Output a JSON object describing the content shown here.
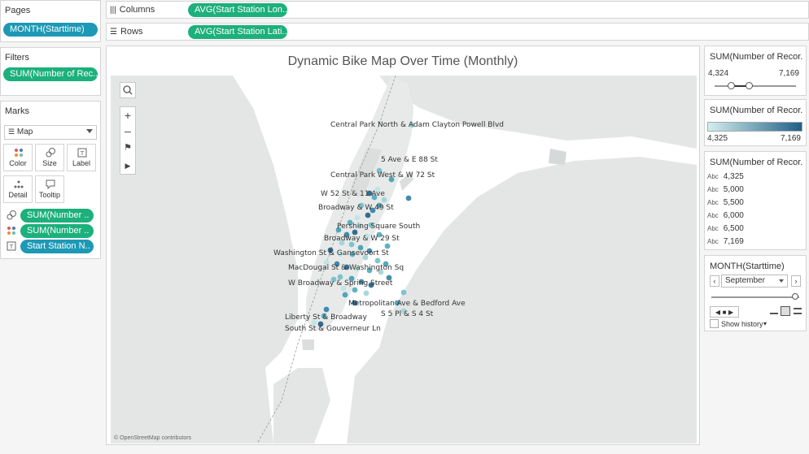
{
  "pages": {
    "title": "Pages",
    "pill": "MONTH(Starttime)"
  },
  "filters": {
    "title": "Filters",
    "pill": "SUM(Number of Rec.."
  },
  "marks": {
    "title": "Marks",
    "type": "Map",
    "cards": [
      {
        "label": "Color",
        "icon": "color-dots-icon"
      },
      {
        "label": "Size",
        "icon": "size-icon"
      },
      {
        "label": "Label",
        "icon": "label-icon"
      },
      {
        "label": "Detail",
        "icon": "detail-icon"
      },
      {
        "label": "Tooltip",
        "icon": "tooltip-icon"
      }
    ],
    "fields": [
      {
        "label": "SUM(Number ..",
        "icon": "size-icon"
      },
      {
        "label": "SUM(Number ..",
        "icon": "color-dots-icon"
      },
      {
        "label": "Start Station N..",
        "icon": "label-icon"
      }
    ]
  },
  "shelves": {
    "columns": {
      "label": "Columns",
      "pill": "AVG(Start Station Lon.."
    },
    "rows": {
      "label": "Rows",
      "pill": "AVG(Start Station Lati.."
    }
  },
  "viz": {
    "title": "Dynamic Bike Map Over Time (Monthly)",
    "attribution": "© OpenStreetMap contributors",
    "station_labels": [
      "Central Park North & Adam Clayton Powell Blvd",
      "5 Ave & E 88 St",
      "Central Park West & W 72 St",
      "W 52 St & 11 Ave",
      "Broadway & W 49 St",
      "Pershing Square South",
      "Broadway & W 29 St",
      "Washington St & Gansevoort St",
      "MacDougal St & Washington Sq",
      "W Broadway & Spring Street",
      "Metropolitan Ave & Bedford Ave",
      "S 5 Pl & S 4 St",
      "Liberty St & Broadway",
      "South St & Gouverneur Ln"
    ]
  },
  "legend_slider": {
    "title": "SUM(Number of Recor..",
    "min": "4,324",
    "max": "7,169"
  },
  "legend_color": {
    "title": "SUM(Number of Recor..",
    "min": "4,325",
    "max": "7,169",
    "color_low": "#d2eeee",
    "color_high": "#1f5f86"
  },
  "legend_label": {
    "title": "SUM(Number of Recor..",
    "abc": "Abc",
    "items": [
      "4,325",
      "5,000",
      "5,500",
      "6,000",
      "6,500",
      "7,169"
    ]
  },
  "month_filter": {
    "title": "MONTH(Starttime)",
    "selected": "September",
    "slider_fraction": 0.95,
    "show_history": "Show history"
  },
  "colors": {
    "accent_blue": "#1d99b5",
    "accent_green": "#1cb07c"
  }
}
